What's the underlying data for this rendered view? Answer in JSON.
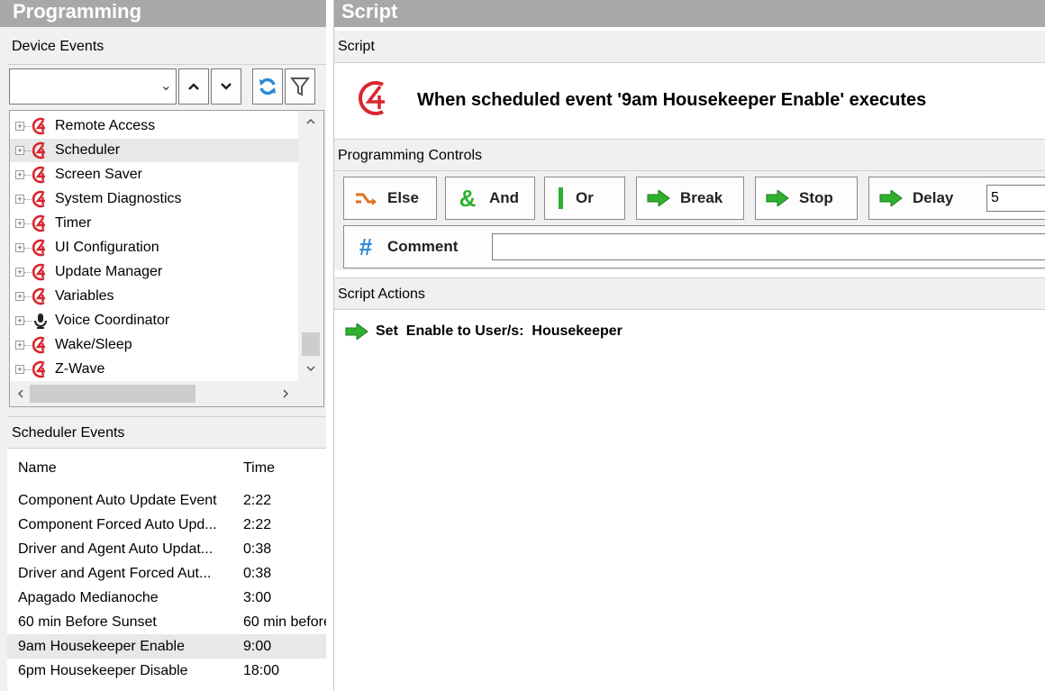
{
  "left": {
    "panel_title": "Programming",
    "device_events_label": "Device Events",
    "toolbar": {
      "combo_value": "",
      "up_icon": "chevron-up-icon",
      "down_icon": "chevron-down-icon",
      "refresh_icon": "refresh-icon",
      "filter_icon": "filter-icon"
    },
    "tree_items": [
      {
        "label": "Remote Access",
        "icon": "c4-logo-icon"
      },
      {
        "label": "Scheduler",
        "icon": "c4-logo-icon",
        "selected": true
      },
      {
        "label": "Screen Saver",
        "icon": "c4-logo-icon"
      },
      {
        "label": "System Diagnostics",
        "icon": "c4-logo-icon"
      },
      {
        "label": "Timer",
        "icon": "c4-logo-icon"
      },
      {
        "label": "UI Configuration",
        "icon": "c4-logo-icon"
      },
      {
        "label": "Update Manager",
        "icon": "c4-logo-icon"
      },
      {
        "label": "Variables",
        "icon": "c4-logo-icon"
      },
      {
        "label": "Voice Coordinator",
        "icon": "microphone-icon"
      },
      {
        "label": "Wake/Sleep",
        "icon": "c4-logo-icon"
      },
      {
        "label": "Z-Wave",
        "icon": "c4-logo-icon"
      }
    ],
    "scheduler_events_label": "Scheduler Events",
    "columns": {
      "name": "Name",
      "time": "Time"
    },
    "events": [
      {
        "name": "Component Auto Update Event",
        "time": "2:22"
      },
      {
        "name": "Component Forced Auto Upd...",
        "time": "2:22"
      },
      {
        "name": "Driver and Agent Auto Updat...",
        "time": "0:38"
      },
      {
        "name": "Driver and Agent Forced Aut...",
        "time": "0:38"
      },
      {
        "name": "Apagado Medianoche",
        "time": "3:00"
      },
      {
        "name": "60 min Before Sunset",
        "time": "60 min before"
      },
      {
        "name": "9am Housekeeper Enable",
        "time": "9:00",
        "selected": true
      },
      {
        "name": "6pm Housekeeper Disable",
        "time": "18:00"
      }
    ]
  },
  "right": {
    "panel_title": "Script",
    "script_label": "Script",
    "script_heading": "When scheduled event '9am Housekeeper Enable' executes",
    "programming_controls_label": "Programming Controls",
    "controls": {
      "else": "Else",
      "and": "And",
      "or": "Or",
      "break": "Break",
      "stop": "Stop",
      "delay": "Delay",
      "delay_value": "5",
      "comment": "Comment",
      "comment_value": ""
    },
    "script_actions_label": "Script Actions",
    "actions": [
      {
        "text": "Set  Enable to User/s:  Housekeeper",
        "icon": "green-arrow-icon"
      }
    ]
  },
  "colors": {
    "c4_red": "#d8262f",
    "green": "#2fb12f",
    "blue": "#2a8ad8",
    "title_bar": "#a8a8a8"
  }
}
